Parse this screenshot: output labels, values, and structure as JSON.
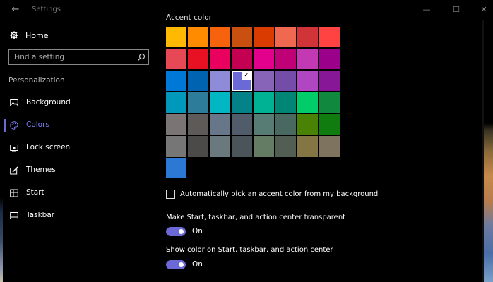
{
  "window": {
    "title": "Settings",
    "minimize": "—",
    "maximize": "☐",
    "close": "✕",
    "back": "←"
  },
  "sidebar": {
    "home_label": "Home",
    "search_placeholder": "Find a setting",
    "section": "Personalization",
    "items": [
      {
        "label": "Background",
        "icon": "image-icon"
      },
      {
        "label": "Colors",
        "icon": "palette-icon",
        "active": true
      },
      {
        "label": "Lock screen",
        "icon": "lock-screen-icon"
      },
      {
        "label": "Themes",
        "icon": "themes-icon"
      },
      {
        "label": "Start",
        "icon": "start-icon"
      },
      {
        "label": "Taskbar",
        "icon": "taskbar-icon"
      }
    ]
  },
  "main": {
    "accent_heading": "Accent color",
    "swatches": [
      [
        "#FFB900",
        "#FF8C00",
        "#F7630C",
        "#CA5010",
        "#DA3B01",
        "#EF6950",
        "#D13438",
        "#FF4343"
      ],
      [
        "#E74856",
        "#E81123",
        "#EA005E",
        "#C30052",
        "#E3008C",
        "#BF0077",
        "#C239B3",
        "#9A0089"
      ],
      [
        "#0078D7",
        "#0063B1",
        "#8E8CD8",
        "#6B69D6",
        "#8764B8",
        "#744DA9",
        "#B146C2",
        "#881798"
      ],
      [
        "#0099BC",
        "#2D7D9A",
        "#00B7C3",
        "#038387",
        "#00B294",
        "#018574",
        "#00CC6A",
        "#10893E"
      ],
      [
        "#7A7574",
        "#5D5A58",
        "#68768A",
        "#515C6B",
        "#567C73",
        "#486860",
        "#498205",
        "#107C10"
      ],
      [
        "#767676",
        "#4C4A48",
        "#69797E",
        "#4A5459",
        "#647C64",
        "#525E54",
        "#847545",
        "#7E735F"
      ],
      [
        "#2B79D4"
      ]
    ],
    "selected_swatch": {
      "row": 2,
      "col": 3
    },
    "auto_pick_label": "Automatically pick an accent color from my background",
    "transparent_label": "Make Start, taskbar, and action center transparent",
    "transparent_state": "On",
    "show_color_label": "Show color on Start, taskbar, and action center",
    "show_color_state": "On",
    "accent_toggle_color": "#6B69D6"
  }
}
